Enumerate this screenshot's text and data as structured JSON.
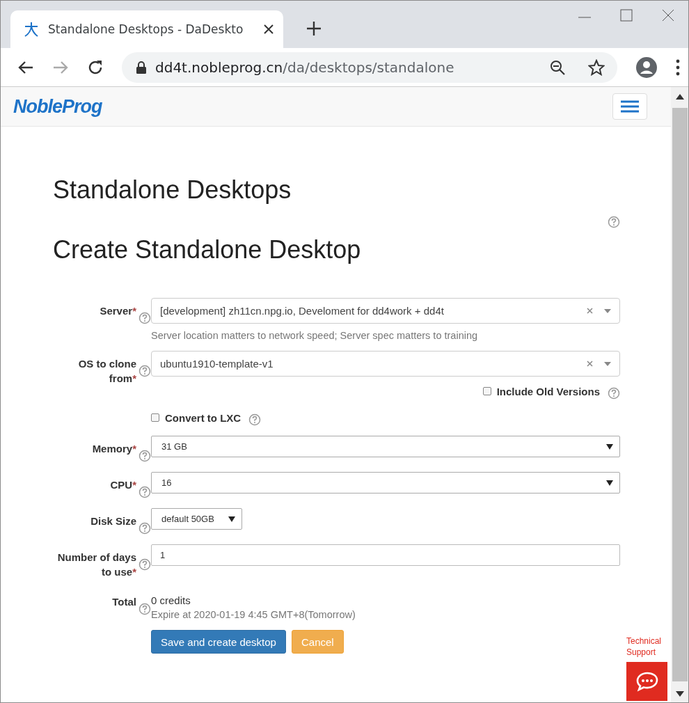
{
  "browser": {
    "tab": {
      "title": "Standalone Desktops - DaDeskto",
      "selected": true
    },
    "url": {
      "host": "dd4t.nobleprog.cn",
      "path": "/da/desktops/standalone"
    }
  },
  "navbar": {
    "brand": "NobleProg"
  },
  "page": {
    "title": "Standalone Desktops",
    "form_title": "Create Standalone Desktop"
  },
  "fields": [
    {
      "kind": "select2",
      "label": "Server",
      "required_mark": "*",
      "value": "[development] zh11cn.npg.io, Develoment for dd4work + dd4t",
      "hint": "Server location matters to network speed; Server spec matters to training"
    },
    {
      "kind": "select2",
      "label": "OS to clone from",
      "required_mark": "*",
      "value": "ubuntu1910-template-v1",
      "extra_checkbox": {
        "label": "Include Old Versions",
        "checked": false
      }
    },
    {
      "kind": "checkbox",
      "label": "Convert to LXC",
      "checked": false
    },
    {
      "kind": "select",
      "label": "Memory",
      "required_mark": "*",
      "value": "31 GB"
    },
    {
      "kind": "select",
      "label": "CPU",
      "required_mark": "*",
      "value": "16"
    },
    {
      "kind": "select_small",
      "label": "Disk Size",
      "value": "default 50GB"
    },
    {
      "kind": "input",
      "label": "Number of days to use",
      "required_mark": "*",
      "value": "1"
    },
    {
      "kind": "static",
      "label": "Total",
      "value": "0 credits",
      "hint": "Expire at 2020-01-19 4:45 GMT+8(Tomorrow)"
    }
  ],
  "buttons": [
    {
      "label": "Save and create desktop",
      "kind": "primary"
    },
    {
      "label": "Cancel",
      "kind": "warning"
    }
  ],
  "support": {
    "label": "Technical Support"
  }
}
